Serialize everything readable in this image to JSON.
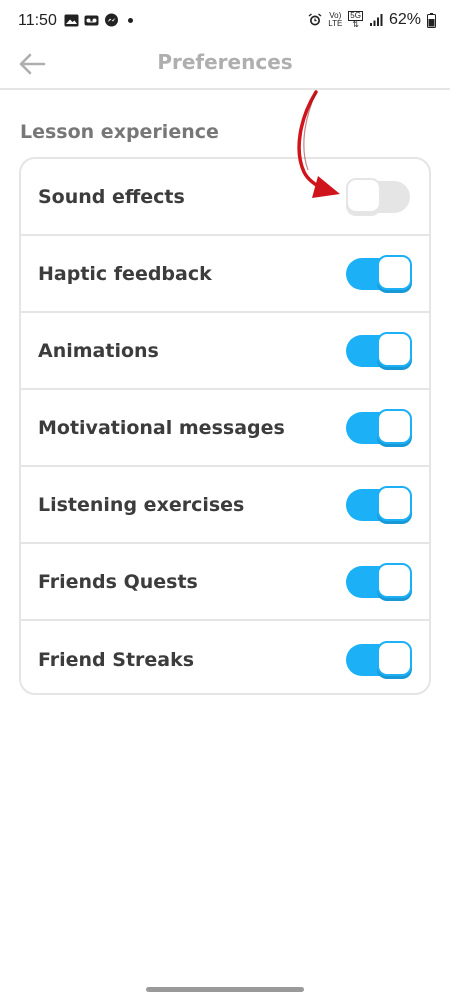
{
  "status_bar": {
    "time": "11:50",
    "battery": "62%",
    "net_top": "Vo)",
    "net_bottom": "LTE",
    "gen_top": "5G",
    "icons": [
      "image-icon",
      "voicemail-icon",
      "messenger-icon",
      "alarm-icon",
      "signal-icon",
      "battery-icon"
    ]
  },
  "header": {
    "title": "Preferences",
    "back_icon": "arrow-left-icon"
  },
  "section": {
    "title": "Lesson experience",
    "items": [
      {
        "label": "Sound effects",
        "enabled": false
      },
      {
        "label": "Haptic feedback",
        "enabled": true
      },
      {
        "label": "Animations",
        "enabled": true
      },
      {
        "label": "Motivational messages",
        "enabled": true
      },
      {
        "label": "Listening exercises",
        "enabled": true
      },
      {
        "label": "Friends Quests",
        "enabled": true
      },
      {
        "label": "Friend Streaks",
        "enabled": true
      }
    ]
  },
  "colors": {
    "accent": "#1cb0f6",
    "accent_shadow": "#1899d6",
    "toggle_off": "#e5e5e5",
    "annotation_arrow": "#d0141c"
  }
}
